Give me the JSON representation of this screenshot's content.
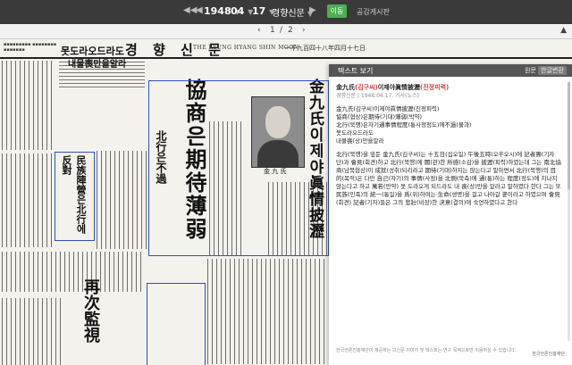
{
  "topbar": {
    "year": "1948",
    "month": "04",
    "day": "17",
    "newspaper": "경향신문",
    "go_label": "이동",
    "link_label": "공감게시판"
  },
  "pager": {
    "current": "1",
    "separator": "/",
    "total": "2"
  },
  "newspaper_page": {
    "masthead_ko": "경 향 신 문",
    "masthead_en": "THE KYUNG HYANG SHIN MOON",
    "masthead_date": "一千九百四十八年四月十七日",
    "headline_main": "金九氏이제야眞情披瀝",
    "headline_sub": "協商은期待薄弱",
    "headline_north": "北行은不過",
    "side_head": "民族陣營은北行에反對",
    "bottom_head": "再次監視",
    "photo_caption": "金 九 氏"
  },
  "panel": {
    "title": "텍스트 보기",
    "tab_original": "원문",
    "tab_korean": "한글변환",
    "article_title_prefix": "金九氏",
    "article_title_ko": "(김구씨)",
    "article_title_suffix": "이제야眞情披瀝",
    "article_title_ko2": "(진정피력)",
    "meta": "경향신문 | 1948.04.17. 기사(뉴스)",
    "lines": [
      "金九氏(김구씨)이제야眞情披瀝(진정피력)",
      "協商(협상)은期待(기대)薄弱(박약)",
      "北行(북행)은자기通事情程度(통사정정도)에不過(불과)",
      "못도라오드라도",
      "내물喪(상)만을알라"
    ],
    "paragraph": "北行(북행)을 앞둔 金九氏(김구씨)는 十五日(십오일) 午後五時(오후오시)에 記者團(기자단)과 會見(회견)하고 北行(북행)에 關(관)한 所感(소감)을 披瀝(피력)하였는데 그는 南北協商(남북협상)이 成就(성취)되리라고 期待(기대)하지는 않는다고 말하면서 北行(북행)의 目的(목적)은 다만 自己(자기)의 事情(사정)을 北側(북측)에 通(통)하는 程度(정도)에 지나지 않는다고 하고 萬若(만약) 못 도라오게 되드라도 내 喪(상)만을 알라고 말하였다 한다 그는 또 民族(민족)의 統一(통일)을 爲(위)하여는 生命(생명)을 걸고 나아갈 뿐이라고 하였으며 會見(회견) 記者(기자)들은 그의 悲壯(비장)한 決意(결의)에 숙연하였다고 한다",
    "footer_note": "한국언론진흥재단이 제공하는 고신문 이미지 및 텍스트는 연구 목적으로만 이용하실 수 있습니다.",
    "footer_logo": "한국언론진흥재단"
  }
}
